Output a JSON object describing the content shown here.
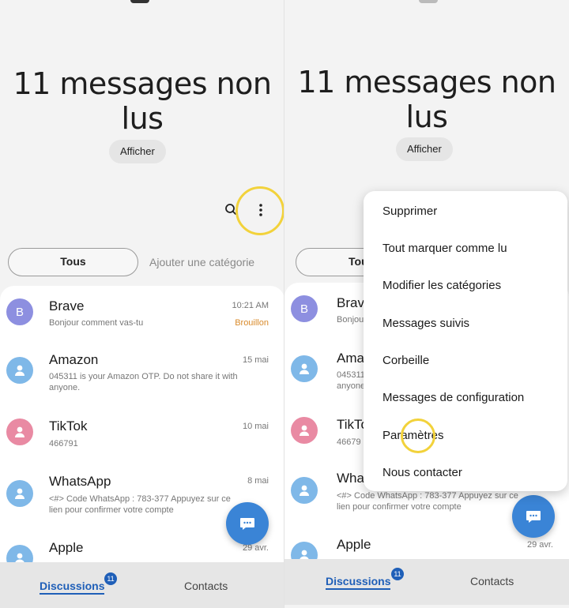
{
  "left": {
    "title": "11 messages non lus",
    "show_label": "Afficher",
    "category_all": "Tous",
    "category_add": "Ajouter une catégorie",
    "conversations": [
      {
        "initial": "B",
        "name": "Brave",
        "snippet": "Bonjour comment vas-tu",
        "time": "10:21 AM",
        "tag": "Brouillon",
        "color": "#8d8fe0"
      },
      {
        "initial": "",
        "name": "Amazon",
        "snippet": "045311 is your Amazon OTP. Do not share it with anyone.",
        "time": "15 mai",
        "tag": "",
        "color": "#7fb8e8"
      },
      {
        "initial": "",
        "name": "TikTok",
        "snippet": "466791",
        "time": "10 mai",
        "tag": "",
        "color": "#e98aa3"
      },
      {
        "initial": "",
        "name": "WhatsApp",
        "snippet": "<#> Code WhatsApp : 783-377  Appuyez sur ce lien pour confirmer votre compte",
        "time": "8 mai",
        "tag": "",
        "color": "#7fb8e8"
      },
      {
        "initial": "",
        "name": "Apple",
        "snippet": "",
        "time": "29 avr.",
        "tag": "",
        "color": "#7fb8e8"
      }
    ],
    "nav": {
      "discussions": "Discussions",
      "badge": "11",
      "contacts": "Contacts"
    }
  },
  "right": {
    "title": "11 messages non lus",
    "show_label": "Afficher",
    "category_all": "Tous",
    "conversations": [
      {
        "initial": "B",
        "name": "Brave",
        "snippet": "Bonjour",
        "color": "#8d8fe0"
      },
      {
        "initial": "",
        "name": "Ama",
        "snippet": "045311 anyone",
        "color": "#7fb8e8"
      },
      {
        "initial": "",
        "name": "TikTo",
        "snippet": "46679",
        "color": "#e98aa3"
      },
      {
        "initial": "",
        "name": "Wha",
        "snippet": "<#> Code WhatsApp : 783-377  Appuyez sur ce lien pour confirmer votre compte",
        "color": "#7fb8e8"
      },
      {
        "initial": "",
        "name": "Apple",
        "snippet": "",
        "time": "29 avr.",
        "color": "#7fb8e8"
      }
    ],
    "menu": [
      "Supprimer",
      "Tout marquer comme lu",
      "Modifier les catégories",
      "Messages suivis",
      "Corbeille",
      "Messages de configuration",
      "Paramètres",
      "Nous contacter"
    ],
    "nav": {
      "discussions": "Discussions",
      "badge": "11",
      "contacts": "Contacts"
    }
  },
  "colors": {
    "accent": "#1f5fb8",
    "fab": "#3a84d6",
    "highlight": "#f2d23b",
    "draft": "#d98a2a"
  },
  "icons": {
    "search": "search-icon",
    "more": "more-vertical-icon",
    "person": "person-icon",
    "chat": "chat-bubble-icon"
  }
}
